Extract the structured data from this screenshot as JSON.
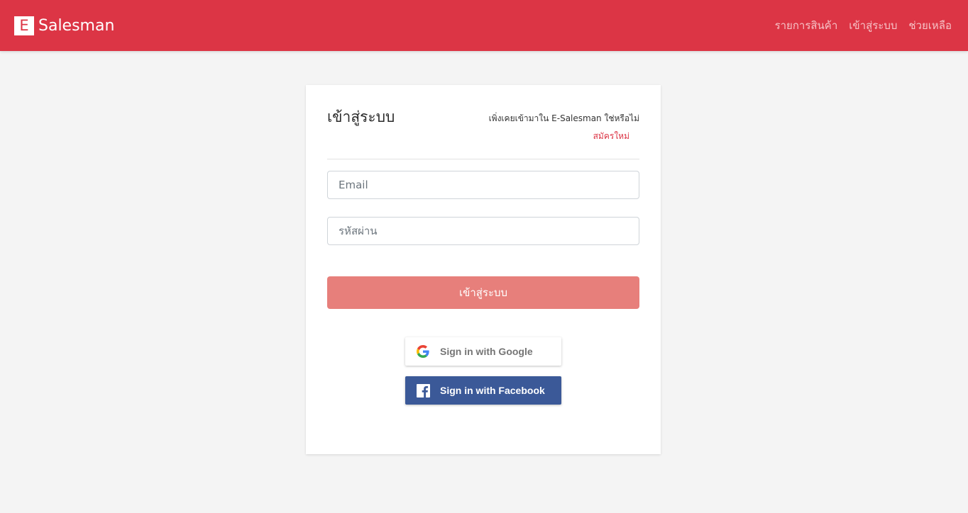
{
  "header": {
    "brand_letter": "E",
    "brand_name": "Salesman",
    "nav": [
      {
        "label": "รายการสินค้า"
      },
      {
        "label": "เข้าสู่ระบบ"
      },
      {
        "label": "ช่วยเหลือ"
      }
    ]
  },
  "login": {
    "title": "เข้าสู่ระบบ",
    "signup_question": "เพิ่งเคยเข้ามาใน E-Salesman ใช่หรือไม่",
    "signup_link": "สมัครใหม่",
    "email_placeholder": "Email",
    "password_placeholder": "รหัสผ่าน",
    "submit_label": "เข้าสู่ระบบ",
    "google_label": "Sign in with Google",
    "facebook_label": "Sign in with Facebook"
  },
  "colors": {
    "brand": "#dc3545",
    "submit_button": "#e77f7b",
    "facebook": "#3b5998"
  },
  "icons": {
    "google": "google-icon",
    "facebook": "facebook-icon"
  }
}
